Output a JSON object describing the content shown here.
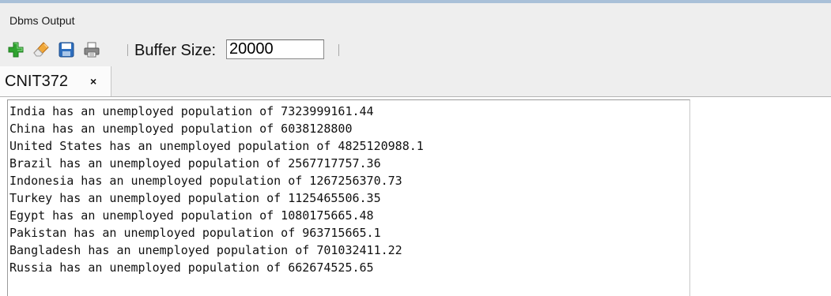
{
  "panel": {
    "title": "Dbms Output"
  },
  "toolbar": {
    "buttons": [
      {
        "icon": "plus-icon",
        "color": "#2fa32f"
      },
      {
        "icon": "eraser-icon",
        "color": "#e8902a"
      },
      {
        "icon": "save-icon",
        "color": "#2e6fbf"
      },
      {
        "icon": "print-icon",
        "color": "#6d6d6d"
      }
    ],
    "buffer_label": "Buffer Size:",
    "buffer_value": "20000"
  },
  "tab": {
    "label": "CNIT372",
    "close_glyph": "×"
  },
  "output": {
    "lines": [
      "India has an unemployed population of 7323999161.44",
      "China has an unemployed population of 6038128800",
      "United States has an unemployed population of 4825120988.1",
      "Brazil has an unemployed population of 2567717757.36",
      "Indonesia has an unemployed population of 1267256370.73",
      "Turkey has an unemployed population of 1125465506.35",
      "Egypt has an unemployed population of 1080175665.48",
      "Pakistan has an unemployed population of 963715665.1",
      "Bangladesh has an unemployed population of 701032411.22",
      "Russia has an unemployed population of 662674525.65"
    ]
  }
}
